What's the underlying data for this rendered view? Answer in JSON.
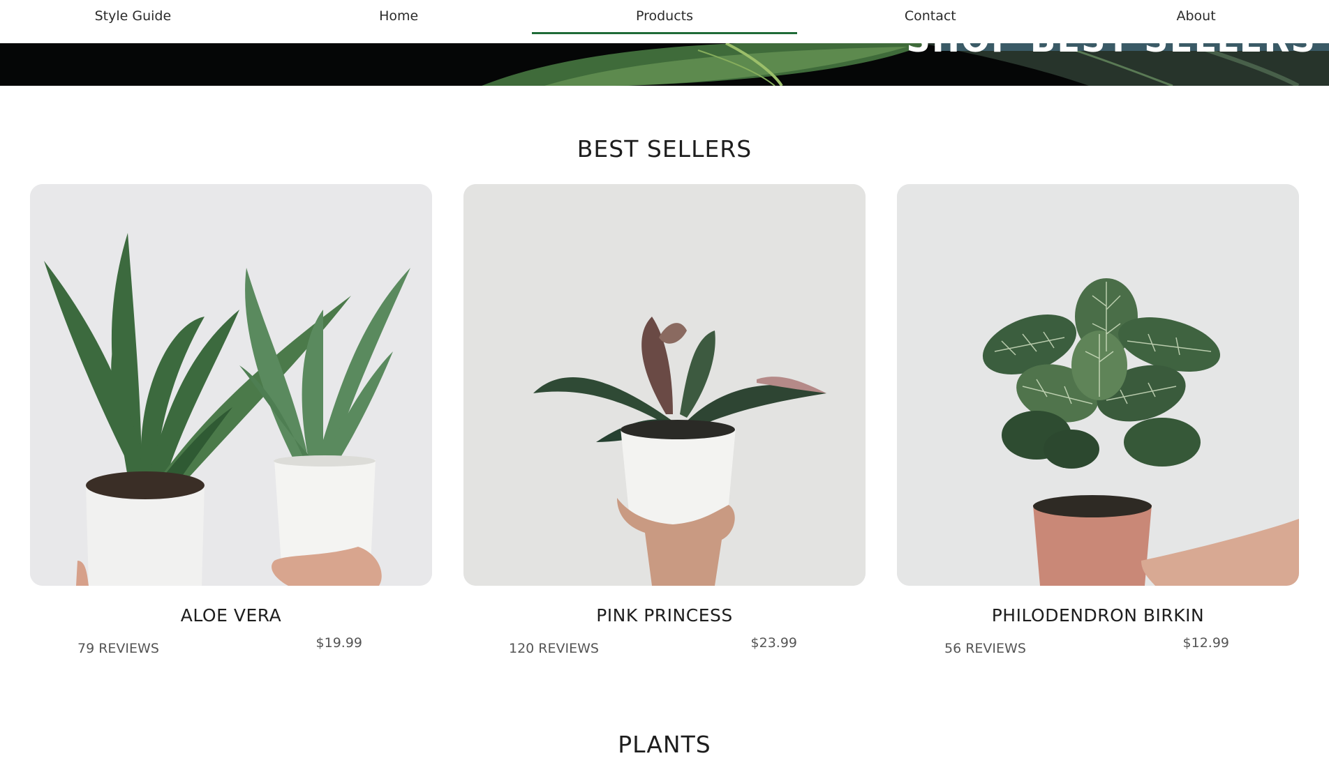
{
  "nav": {
    "items": [
      {
        "label": "Style Guide",
        "active": false
      },
      {
        "label": "Home",
        "active": false
      },
      {
        "label": "Products",
        "active": true
      },
      {
        "label": "Contact",
        "active": false
      },
      {
        "label": "About",
        "active": false
      }
    ]
  },
  "hero": {
    "banner_text": "SHOP BEST SELLERS"
  },
  "best_sellers": {
    "title": "BEST SELLERS",
    "products": [
      {
        "name": "ALOE VERA",
        "reviews": "79 REVIEWS",
        "price": "$19.99"
      },
      {
        "name": "PINK PRINCESS",
        "reviews": "120 REVIEWS",
        "price": "$23.99"
      },
      {
        "name": "PHILODENDRON BIRKIN",
        "reviews": "56 REVIEWS",
        "price": "$12.99"
      }
    ]
  },
  "plants": {
    "title": "PLANTS"
  },
  "colors": {
    "accent": "#1f6b37",
    "banner": "#3a5a66"
  }
}
